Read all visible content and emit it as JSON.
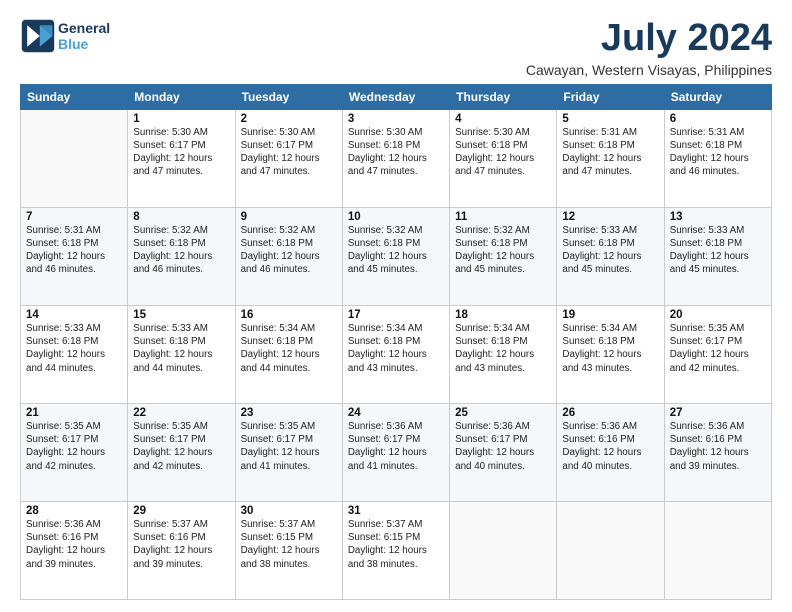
{
  "logo": {
    "line1": "General",
    "line2": "Blue"
  },
  "title": "July 2024",
  "location": "Cawayan, Western Visayas, Philippines",
  "days_header": [
    "Sunday",
    "Monday",
    "Tuesday",
    "Wednesday",
    "Thursday",
    "Friday",
    "Saturday"
  ],
  "weeks": [
    [
      {
        "num": "",
        "info": ""
      },
      {
        "num": "1",
        "info": "Sunrise: 5:30 AM\nSunset: 6:17 PM\nDaylight: 12 hours\nand 47 minutes."
      },
      {
        "num": "2",
        "info": "Sunrise: 5:30 AM\nSunset: 6:17 PM\nDaylight: 12 hours\nand 47 minutes."
      },
      {
        "num": "3",
        "info": "Sunrise: 5:30 AM\nSunset: 6:18 PM\nDaylight: 12 hours\nand 47 minutes."
      },
      {
        "num": "4",
        "info": "Sunrise: 5:30 AM\nSunset: 6:18 PM\nDaylight: 12 hours\nand 47 minutes."
      },
      {
        "num": "5",
        "info": "Sunrise: 5:31 AM\nSunset: 6:18 PM\nDaylight: 12 hours\nand 47 minutes."
      },
      {
        "num": "6",
        "info": "Sunrise: 5:31 AM\nSunset: 6:18 PM\nDaylight: 12 hours\nand 46 minutes."
      }
    ],
    [
      {
        "num": "7",
        "info": "Sunrise: 5:31 AM\nSunset: 6:18 PM\nDaylight: 12 hours\nand 46 minutes."
      },
      {
        "num": "8",
        "info": "Sunrise: 5:32 AM\nSunset: 6:18 PM\nDaylight: 12 hours\nand 46 minutes."
      },
      {
        "num": "9",
        "info": "Sunrise: 5:32 AM\nSunset: 6:18 PM\nDaylight: 12 hours\nand 46 minutes."
      },
      {
        "num": "10",
        "info": "Sunrise: 5:32 AM\nSunset: 6:18 PM\nDaylight: 12 hours\nand 45 minutes."
      },
      {
        "num": "11",
        "info": "Sunrise: 5:32 AM\nSunset: 6:18 PM\nDaylight: 12 hours\nand 45 minutes."
      },
      {
        "num": "12",
        "info": "Sunrise: 5:33 AM\nSunset: 6:18 PM\nDaylight: 12 hours\nand 45 minutes."
      },
      {
        "num": "13",
        "info": "Sunrise: 5:33 AM\nSunset: 6:18 PM\nDaylight: 12 hours\nand 45 minutes."
      }
    ],
    [
      {
        "num": "14",
        "info": "Sunrise: 5:33 AM\nSunset: 6:18 PM\nDaylight: 12 hours\nand 44 minutes."
      },
      {
        "num": "15",
        "info": "Sunrise: 5:33 AM\nSunset: 6:18 PM\nDaylight: 12 hours\nand 44 minutes."
      },
      {
        "num": "16",
        "info": "Sunrise: 5:34 AM\nSunset: 6:18 PM\nDaylight: 12 hours\nand 44 minutes."
      },
      {
        "num": "17",
        "info": "Sunrise: 5:34 AM\nSunset: 6:18 PM\nDaylight: 12 hours\nand 43 minutes."
      },
      {
        "num": "18",
        "info": "Sunrise: 5:34 AM\nSunset: 6:18 PM\nDaylight: 12 hours\nand 43 minutes."
      },
      {
        "num": "19",
        "info": "Sunrise: 5:34 AM\nSunset: 6:18 PM\nDaylight: 12 hours\nand 43 minutes."
      },
      {
        "num": "20",
        "info": "Sunrise: 5:35 AM\nSunset: 6:17 PM\nDaylight: 12 hours\nand 42 minutes."
      }
    ],
    [
      {
        "num": "21",
        "info": "Sunrise: 5:35 AM\nSunset: 6:17 PM\nDaylight: 12 hours\nand 42 minutes."
      },
      {
        "num": "22",
        "info": "Sunrise: 5:35 AM\nSunset: 6:17 PM\nDaylight: 12 hours\nand 42 minutes."
      },
      {
        "num": "23",
        "info": "Sunrise: 5:35 AM\nSunset: 6:17 PM\nDaylight: 12 hours\nand 41 minutes."
      },
      {
        "num": "24",
        "info": "Sunrise: 5:36 AM\nSunset: 6:17 PM\nDaylight: 12 hours\nand 41 minutes."
      },
      {
        "num": "25",
        "info": "Sunrise: 5:36 AM\nSunset: 6:17 PM\nDaylight: 12 hours\nand 40 minutes."
      },
      {
        "num": "26",
        "info": "Sunrise: 5:36 AM\nSunset: 6:16 PM\nDaylight: 12 hours\nand 40 minutes."
      },
      {
        "num": "27",
        "info": "Sunrise: 5:36 AM\nSunset: 6:16 PM\nDaylight: 12 hours\nand 39 minutes."
      }
    ],
    [
      {
        "num": "28",
        "info": "Sunrise: 5:36 AM\nSunset: 6:16 PM\nDaylight: 12 hours\nand 39 minutes."
      },
      {
        "num": "29",
        "info": "Sunrise: 5:37 AM\nSunset: 6:16 PM\nDaylight: 12 hours\nand 39 minutes."
      },
      {
        "num": "30",
        "info": "Sunrise: 5:37 AM\nSunset: 6:15 PM\nDaylight: 12 hours\nand 38 minutes."
      },
      {
        "num": "31",
        "info": "Sunrise: 5:37 AM\nSunset: 6:15 PM\nDaylight: 12 hours\nand 38 minutes."
      },
      {
        "num": "",
        "info": ""
      },
      {
        "num": "",
        "info": ""
      },
      {
        "num": "",
        "info": ""
      }
    ]
  ]
}
